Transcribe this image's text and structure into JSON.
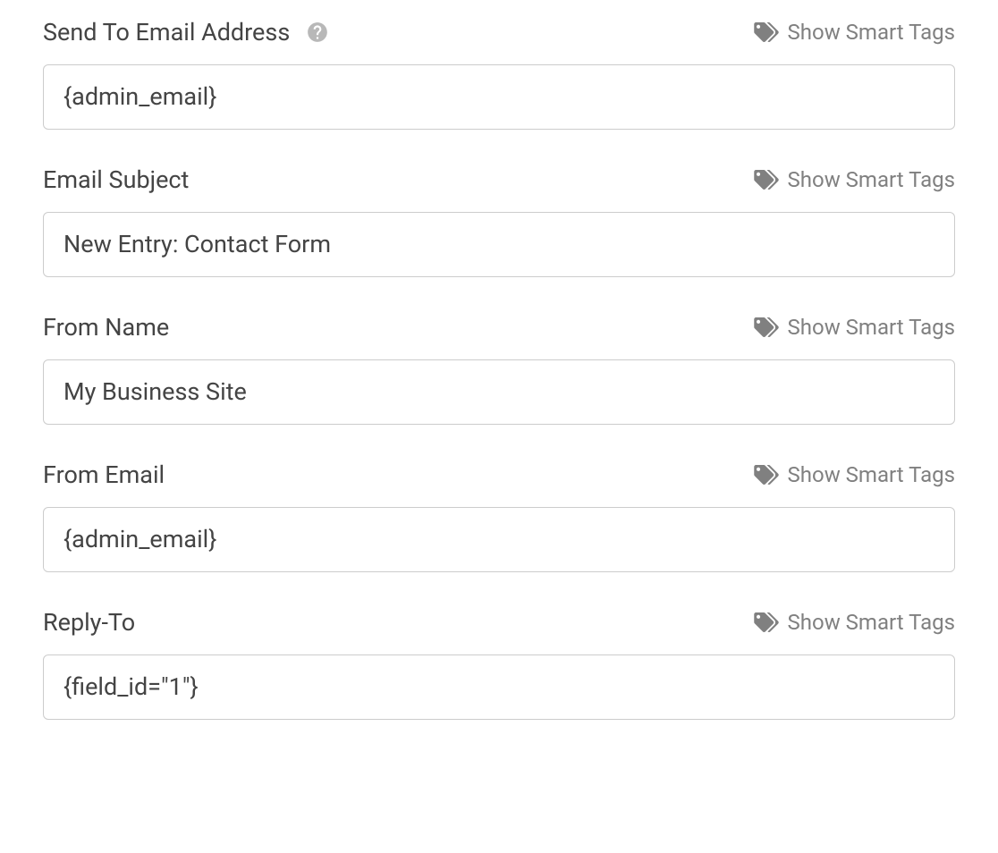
{
  "smart_tags_label": "Show Smart Tags",
  "fields": {
    "send_to": {
      "label": "Send To Email Address",
      "value": "{admin_email}",
      "has_help": true
    },
    "subject": {
      "label": "Email Subject",
      "value": "New Entry: Contact Form",
      "has_help": false
    },
    "from_name": {
      "label": "From Name",
      "value": "My Business Site",
      "has_help": false
    },
    "from_email": {
      "label": "From Email",
      "value": "{admin_email}",
      "has_help": false
    },
    "reply_to": {
      "label": "Reply-To",
      "value": "{field_id=\"1\"}",
      "has_help": false
    }
  }
}
